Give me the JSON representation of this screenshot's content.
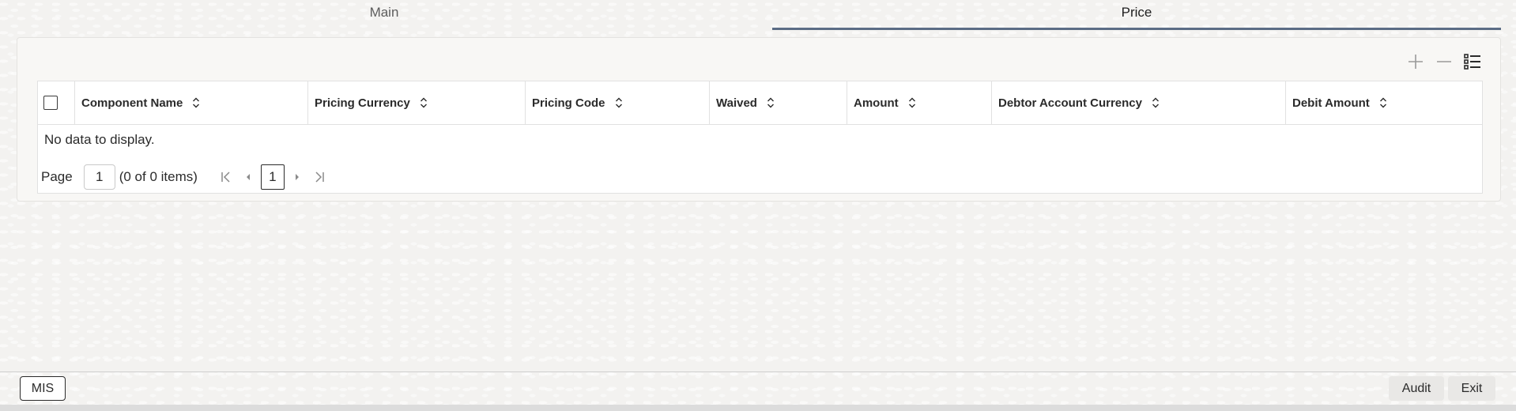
{
  "tabs": [
    {
      "label": "Main",
      "active": false
    },
    {
      "label": "Price",
      "active": true
    }
  ],
  "toolbar": {
    "add_icon": "plus-icon",
    "remove_icon": "minus-icon",
    "columns_icon": "list-view-icon"
  },
  "table": {
    "columns": [
      "Component Name",
      "Pricing Currency",
      "Pricing Code",
      "Waived",
      "Amount",
      "Debtor Account Currency",
      "Debit Amount"
    ],
    "rows": [],
    "empty_message": "No data to display."
  },
  "pagination": {
    "page_label": "Page",
    "page_value": "1",
    "items_text": "(0 of 0 items)",
    "current_page": "1"
  },
  "footer": {
    "mis_label": "MIS",
    "audit_label": "Audit",
    "exit_label": "Exit"
  },
  "colors": {
    "active_tab_underline": "#5b6c85",
    "background": "#f3f2f0"
  }
}
